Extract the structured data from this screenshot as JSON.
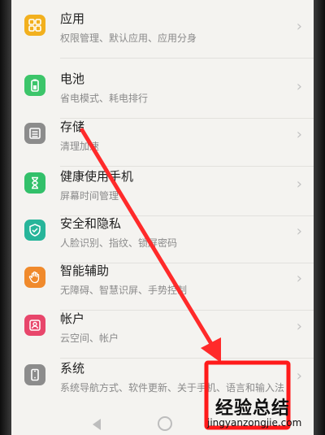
{
  "settings": {
    "items": [
      {
        "title": "应用",
        "subtitle": "权限管理、默认应用、应用分身",
        "icon": "apps-icon",
        "color": "#f2b01e"
      },
      {
        "title": "电池",
        "subtitle": "省电模式、耗电排行",
        "icon": "battery-icon",
        "color": "#3cc56a"
      },
      {
        "title": "存储",
        "subtitle": "清理加速",
        "icon": "storage-icon",
        "color": "#8c8c8c"
      },
      {
        "title": "健康使用手机",
        "subtitle": "屏幕时间管理",
        "icon": "hourglass-icon",
        "color": "#32c06a"
      },
      {
        "title": "安全和隐私",
        "subtitle": "人脸识别、指纹、锁屏密码",
        "icon": "shield-icon",
        "color": "#27b59a"
      },
      {
        "title": "智能辅助",
        "subtitle": "无障碍、智慧识屏、手势控制",
        "icon": "hand-icon",
        "color": "#f08a2c"
      },
      {
        "title": "帐户",
        "subtitle": "云空间、帐户",
        "icon": "account-icon",
        "color": "#e8466b"
      },
      {
        "title": "系统",
        "subtitle": "系统导航方式、软件更新、关于手机、语言和输入法",
        "icon": "system-icon",
        "color": "#8c8c8c"
      }
    ],
    "chevron": "›"
  },
  "annotation": {
    "arrow_color": "#ff2a2a",
    "box_color": "#ff1a1a"
  },
  "watermark": {
    "main": "经验总结",
    "url": "jingyanzongjie.com"
  }
}
